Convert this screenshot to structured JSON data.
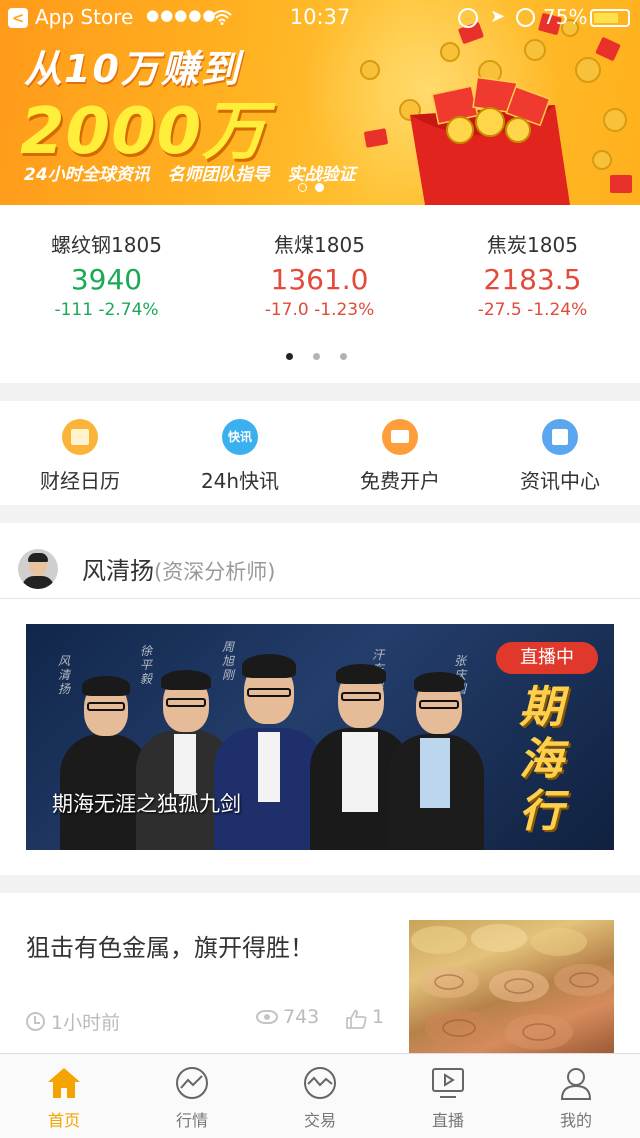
{
  "status_bar": {
    "carrier": "App Store",
    "signal": "●●●●●",
    "time": "10:37",
    "battery": "75%",
    "battery_level": 0.75
  },
  "banner": {
    "line1": "从10万赚到",
    "line2": "2000万",
    "line3": "24小时全球资讯 名师团队指导 实战验证",
    "page_count": 2,
    "active_page": 2
  },
  "quotes": [
    {
      "name": "螺纹钢1805",
      "price": "3940",
      "change": "-111 -2.74%",
      "color": "#1aaa55"
    },
    {
      "name": "焦煤1805",
      "price": "1361.0",
      "change": "-17.0 -1.23%",
      "color": "#e24a3b"
    },
    {
      "name": "焦炭1805",
      "price": "2183.5",
      "change": "-27.5 -1.24%",
      "color": "#e24a3b"
    }
  ],
  "quotes_pager": {
    "pages": 3,
    "active": 1
  },
  "quick_menu": [
    {
      "label": "财经日历",
      "icon": "calendar-icon",
      "color": "#fbb33a"
    },
    {
      "label": "24h快讯",
      "icon": "flash-news-icon",
      "icon_text": "快讯",
      "color": "#3ab0f0"
    },
    {
      "label": "免费开户",
      "icon": "card-icon",
      "color": "#ff9d3a"
    },
    {
      "label": "资讯中心",
      "icon": "chart-news-icon",
      "color": "#5aa7f0"
    }
  ],
  "analyst": {
    "name": "风清扬",
    "role": "(资深分析师)",
    "video_title": "期海无涯之独孤九剑",
    "live_badge": "直播中",
    "video_brand": "期海行"
  },
  "news": {
    "title": "狙击有色金属，旗开得胜！",
    "time": "1小时前",
    "views": "743",
    "likes": "1"
  },
  "tabs": [
    {
      "label": "首页",
      "icon": "home-icon",
      "active": true
    },
    {
      "label": "行情",
      "icon": "market-icon",
      "active": false
    },
    {
      "label": "交易",
      "icon": "trade-icon",
      "active": false
    },
    {
      "label": "直播",
      "icon": "live-icon",
      "active": false
    },
    {
      "label": "我的",
      "icon": "profile-icon",
      "active": false
    }
  ],
  "colors": {
    "accent": "#f5a300",
    "up_red": "#e24a3b",
    "down_green": "#1aaa55"
  }
}
